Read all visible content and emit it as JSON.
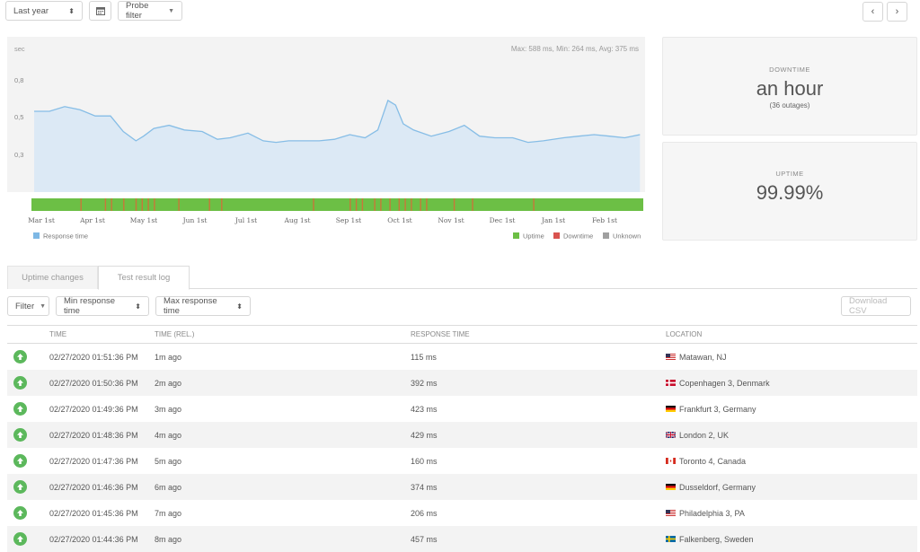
{
  "toolbar": {
    "range_label": "Last year",
    "probe_filter_label": "Probe filter"
  },
  "chart_data": {
    "type": "area",
    "stats_text": "Max: 588 ms, Min: 264 ms, Avg: 375 ms",
    "ylabel": "sec",
    "yticks": [
      "0,8",
      "0,5",
      "0,3"
    ],
    "ylim": [
      0,
      1.0
    ],
    "months": [
      "Mar 1st",
      "Apr 1st",
      "May 1st",
      "Jun 1st",
      "Jul 1st",
      "Aug 1st",
      "Sep 1st",
      "Oct 1st",
      "Nov 1st",
      "Dec 1st",
      "Jan 1st",
      "Feb 1st"
    ],
    "x": [
      0,
      0.3,
      0.6,
      0.9,
      1.2,
      1.5,
      1.75,
      2.0,
      2.15,
      2.35,
      2.65,
      2.95,
      3.3,
      3.6,
      3.85,
      4.2,
      4.5,
      4.75,
      5.0,
      5.3,
      5.6,
      5.9,
      6.2,
      6.5,
      6.75,
      6.95,
      7.1,
      7.25,
      7.45,
      7.8,
      8.15,
      8.45,
      8.75,
      9.05,
      9.4,
      9.7,
      10.0,
      10.4,
      10.7,
      11.0,
      11.3,
      11.6,
      11.9
    ],
    "values": [
      0.52,
      0.52,
      0.55,
      0.53,
      0.49,
      0.49,
      0.39,
      0.33,
      0.36,
      0.41,
      0.43,
      0.4,
      0.39,
      0.34,
      0.35,
      0.38,
      0.33,
      0.32,
      0.33,
      0.33,
      0.33,
      0.34,
      0.37,
      0.35,
      0.4,
      0.59,
      0.56,
      0.44,
      0.4,
      0.36,
      0.39,
      0.43,
      0.36,
      0.35,
      0.35,
      0.32,
      0.33,
      0.35,
      0.36,
      0.37,
      0.36,
      0.35,
      0.37
    ],
    "series_name": "Response time",
    "status_bar": {
      "downtime_positions": [
        0.08,
        0.12,
        0.13,
        0.15,
        0.17,
        0.18,
        0.19,
        0.2,
        0.24,
        0.29,
        0.31,
        0.46,
        0.52,
        0.53,
        0.54,
        0.56,
        0.57,
        0.585,
        0.6,
        0.61,
        0.62,
        0.635,
        0.645,
        0.69,
        0.72,
        0.82
      ]
    },
    "legend": [
      "Uptime",
      "Downtime",
      "Unknown"
    ],
    "colors": {
      "area": "#dce9f5",
      "line": "#86bde6",
      "uptime": "#6cbf45",
      "downtime": "#d9534f",
      "unknown": "#a0a0a0",
      "response": "#7eb8e5"
    }
  },
  "cards": {
    "downtime": {
      "label": "DOWNTIME",
      "value": "an hour",
      "sub": "(36 outages)"
    },
    "uptime": {
      "label": "UPTIME",
      "value": "99.99%"
    }
  },
  "tabs": [
    {
      "label": "Uptime changes"
    },
    {
      "label": "Test result log"
    }
  ],
  "filters": {
    "filter_label": "Filter",
    "min_label": "Min response time",
    "max_label": "Max response time",
    "download_label": "Download CSV"
  },
  "table": {
    "headers": {
      "time": "TIME",
      "rel": "TIME (REL.)",
      "resp": "RESPONSE TIME",
      "loc": "LOCATION"
    },
    "rows": [
      {
        "time": "02/27/2020 01:51:36 PM",
        "rel": "1m ago",
        "resp": "115 ms",
        "loc": "Matawan, NJ",
        "flag": "us"
      },
      {
        "time": "02/27/2020 01:50:36 PM",
        "rel": "2m ago",
        "resp": "392 ms",
        "loc": "Copenhagen 3, Denmark",
        "flag": "dk"
      },
      {
        "time": "02/27/2020 01:49:36 PM",
        "rel": "3m ago",
        "resp": "423 ms",
        "loc": "Frankfurt 3, Germany",
        "flag": "de"
      },
      {
        "time": "02/27/2020 01:48:36 PM",
        "rel": "4m ago",
        "resp": "429 ms",
        "loc": "London 2, UK",
        "flag": "uk"
      },
      {
        "time": "02/27/2020 01:47:36 PM",
        "rel": "5m ago",
        "resp": "160 ms",
        "loc": "Toronto 4, Canada",
        "flag": "ca"
      },
      {
        "time": "02/27/2020 01:46:36 PM",
        "rel": "6m ago",
        "resp": "374 ms",
        "loc": "Dusseldorf, Germany",
        "flag": "de"
      },
      {
        "time": "02/27/2020 01:45:36 PM",
        "rel": "7m ago",
        "resp": "206 ms",
        "loc": "Philadelphia 3, PA",
        "flag": "us"
      },
      {
        "time": "02/27/2020 01:44:36 PM",
        "rel": "8m ago",
        "resp": "457 ms",
        "loc": "Falkenberg, Sweden",
        "flag": "se"
      }
    ]
  }
}
